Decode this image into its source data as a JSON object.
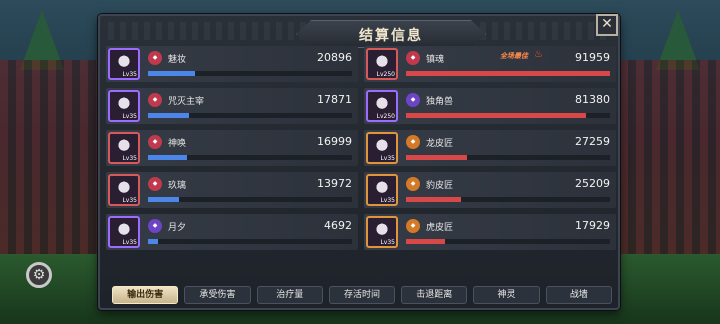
{
  "panel": {
    "title": "结算信息"
  },
  "left_team": [
    {
      "name": "魅妆",
      "value": "20896",
      "level": "Lv35",
      "fill": 0.23
    },
    {
      "name": "咒灭主宰",
      "value": "17871",
      "level": "Lv35",
      "fill": 0.2
    },
    {
      "name": "神唤",
      "value": "16999",
      "level": "Lv35",
      "fill": 0.19
    },
    {
      "name": "玖璃",
      "value": "13972",
      "level": "Lv35",
      "fill": 0.15
    },
    {
      "name": "月夕",
      "value": "4692",
      "level": "Lv35",
      "fill": 0.05
    }
  ],
  "right_team": [
    {
      "name": "镇魂",
      "value": "91959",
      "level": "Lv250",
      "fill": 1.0,
      "mvp": "全场最佳",
      "badge": "red"
    },
    {
      "name": "独角兽",
      "value": "81380",
      "level": "Lv250",
      "fill": 0.88,
      "badge": "purple"
    },
    {
      "name": "龙皮匠",
      "value": "27259",
      "level": "Lv35",
      "fill": 0.3,
      "badge": "orange"
    },
    {
      "name": "豹皮匠",
      "value": "25209",
      "level": "Lv35",
      "fill": 0.27,
      "badge": "orange"
    },
    {
      "name": "虎皮匠",
      "value": "17929",
      "level": "Lv35",
      "fill": 0.19,
      "badge": "orange"
    }
  ],
  "tabs": [
    {
      "label": "输出伤害",
      "active": true
    },
    {
      "label": "承受伤害",
      "active": false
    },
    {
      "label": "治疗量",
      "active": false
    },
    {
      "label": "存活时间",
      "active": false
    },
    {
      "label": "击退距离",
      "active": false
    },
    {
      "label": "神灵",
      "active": false
    },
    {
      "label": "战墙",
      "active": false
    }
  ],
  "icons": {
    "close": "close-x-icon",
    "settings": "gear-icon",
    "mvp": "flame-icon"
  },
  "colors": {
    "ally_bar": "#4b86e8",
    "enemy_bar": "#d94848",
    "active_tab": "#efe3c4"
  }
}
